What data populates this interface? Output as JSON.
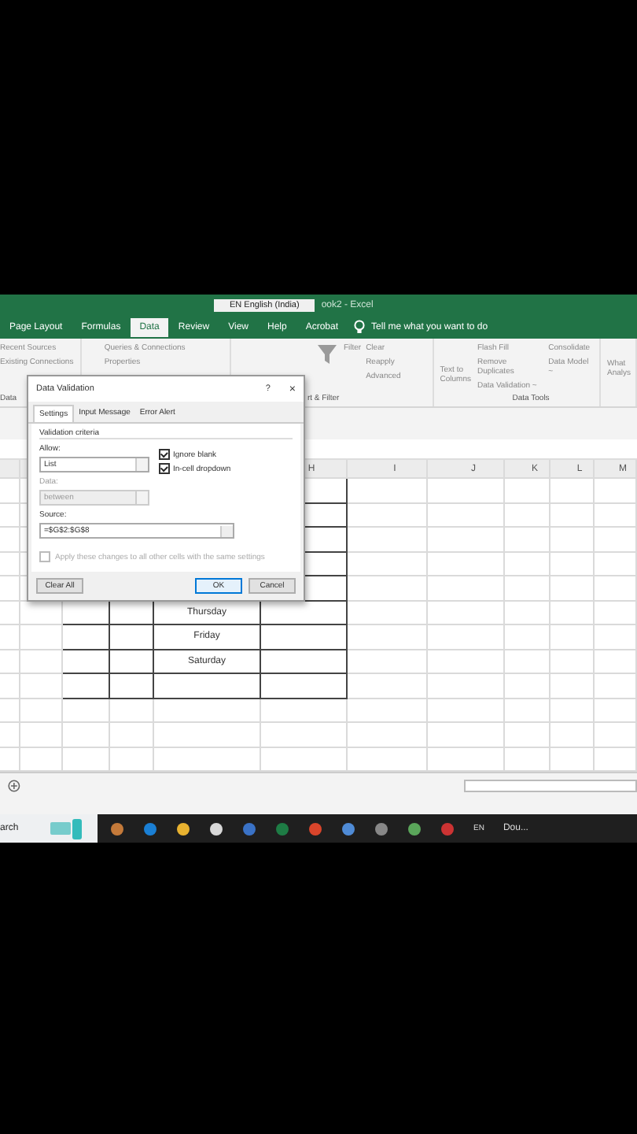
{
  "title_bar": {
    "language": "EN English (India)",
    "title": "ook2 - Excel"
  },
  "ribbon_tabs": [
    {
      "label": "Page Layout",
      "selected": false
    },
    {
      "label": "Formulas",
      "selected": false
    },
    {
      "label": "Data",
      "selected": true
    },
    {
      "label": "Review",
      "selected": false
    },
    {
      "label": "View",
      "selected": false
    },
    {
      "label": "Help",
      "selected": false
    },
    {
      "label": "Acrobat",
      "selected": false
    }
  ],
  "tell_me": "Tell me what you want to do",
  "ribbon": {
    "connections": [
      "Recent Sources",
      "Existing Connections"
    ],
    "data_group": "Data",
    "queries": [
      "Queries & Connections",
      "Properties"
    ],
    "filter": "Filter",
    "filter_items": [
      "Clear",
      "Reapply",
      "Advanced"
    ],
    "sort_filter_group": "rt & Filter",
    "text_to_columns": "Text to Columns",
    "tools": [
      "Flash Fill",
      "Remove Duplicates",
      "Data Validation ~"
    ],
    "model": [
      "Consolidate",
      "Data Model ~"
    ],
    "data_tools_group": "Data Tools",
    "what_if": "What Analys"
  },
  "column_headers": [
    "H",
    "I",
    "J",
    "K",
    "L",
    "M"
  ],
  "day_cells": [
    {
      "text": "Thursday"
    },
    {
      "text": "Friday"
    },
    {
      "text": "Saturday"
    }
  ],
  "dialog": {
    "title": "Data Validation",
    "help": "?",
    "close": "×",
    "tabs": [
      {
        "label": "Settings",
        "selected": true
      },
      {
        "label": "Input Message",
        "selected": false
      },
      {
        "label": "Error Alert",
        "selected": false
      }
    ],
    "criteria": "Validation criteria",
    "allow_label": "Allow:",
    "allow_value": "List",
    "options": [
      {
        "label": "Ignore blank",
        "checked": true
      },
      {
        "label": "In-cell dropdown",
        "checked": true
      }
    ],
    "data_label": "Data:",
    "data_value": "between",
    "data_disabled": true,
    "source_label": "Source:",
    "source_value": "=$G$2:$G$8",
    "apply": {
      "label": "Apply these changes to all other cells with the same settings",
      "checked": false,
      "disabled": true
    },
    "buttons": [
      "Clear All",
      "OK",
      "Cancel"
    ]
  },
  "taskbar": {
    "search": "arch",
    "language": "EN",
    "app": "Dou..."
  }
}
